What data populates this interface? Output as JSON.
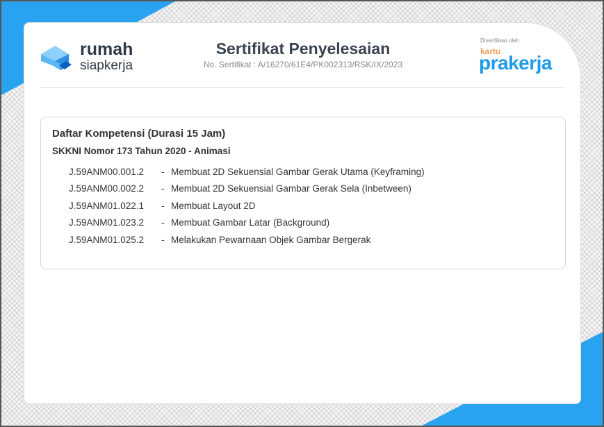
{
  "logo": {
    "line1": "rumah",
    "line2": "siapkerja"
  },
  "header": {
    "title": "Sertifikat Penyelesaian",
    "cert_no": "No. Sertifikat : A/16270/61E4/PK002313/RSK/IX/2023"
  },
  "verifier": {
    "label": "Diverifikasi oleh",
    "brand_small": "kartu",
    "brand": "prakerja"
  },
  "competency": {
    "title": "Daftar Kompetensi (Durasi 15 Jam)",
    "standard": "SKKNI Nomor 173 Tahun 2020 - Animasi",
    "items": [
      {
        "code": "J.59ANM00.001.2",
        "name": "Membuat 2D Sekuensial Gambar Gerak Utama (Keyframing)"
      },
      {
        "code": "J.59ANM00.002.2",
        "name": "Membuat 2D Sekuensial Gambar Gerak Sela (Inbetween)"
      },
      {
        "code": "J.59ANM01.022.1",
        "name": "Membuat Layout 2D"
      },
      {
        "code": "J.59ANM01.023.2",
        "name": "Membuat Gambar Latar (Background)"
      },
      {
        "code": "J.59ANM01.025.2",
        "name": "Melakukan Pewarnaan Objek Gambar Bergerak"
      }
    ],
    "separator": "-"
  },
  "colors": {
    "accent": "#29a3f0",
    "orange": "#f49b5a",
    "text": "#333333"
  }
}
